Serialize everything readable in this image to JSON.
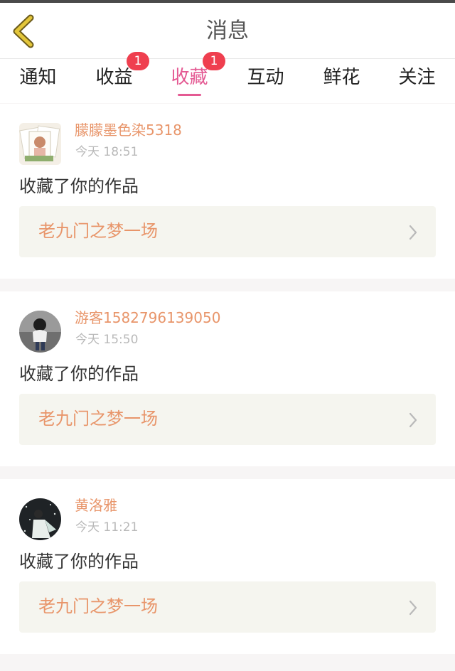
{
  "header": {
    "title": "消息",
    "back_icon": "chevron-left-icon"
  },
  "tabs": [
    {
      "label": "通知",
      "badge": "",
      "active": false
    },
    {
      "label": "收益",
      "badge": "1",
      "active": false
    },
    {
      "label": "收藏",
      "badge": "1",
      "active": true
    },
    {
      "label": "互动",
      "badge": "",
      "active": false
    },
    {
      "label": "鲜花",
      "badge": "",
      "active": false
    },
    {
      "label": "关注",
      "badge": "",
      "active": false
    }
  ],
  "messages": [
    {
      "user": "朦朦墨色染5318",
      "time": "今天 18:51",
      "action": "收藏了你的作品",
      "work": "老九门之梦一场"
    },
    {
      "user": "游客1582796139050",
      "time": "今天 15:50",
      "action": "收藏了你的作品",
      "work": "老九门之梦一场"
    },
    {
      "user": "黄洛雅",
      "time": "今天 11:21",
      "action": "收藏了你的作品",
      "work": "老九门之梦一场"
    }
  ],
  "colors": {
    "accent": "#e45a93",
    "username": "#e8956a",
    "badge": "#ef3f4f",
    "back_icon": "#e3c63a"
  }
}
